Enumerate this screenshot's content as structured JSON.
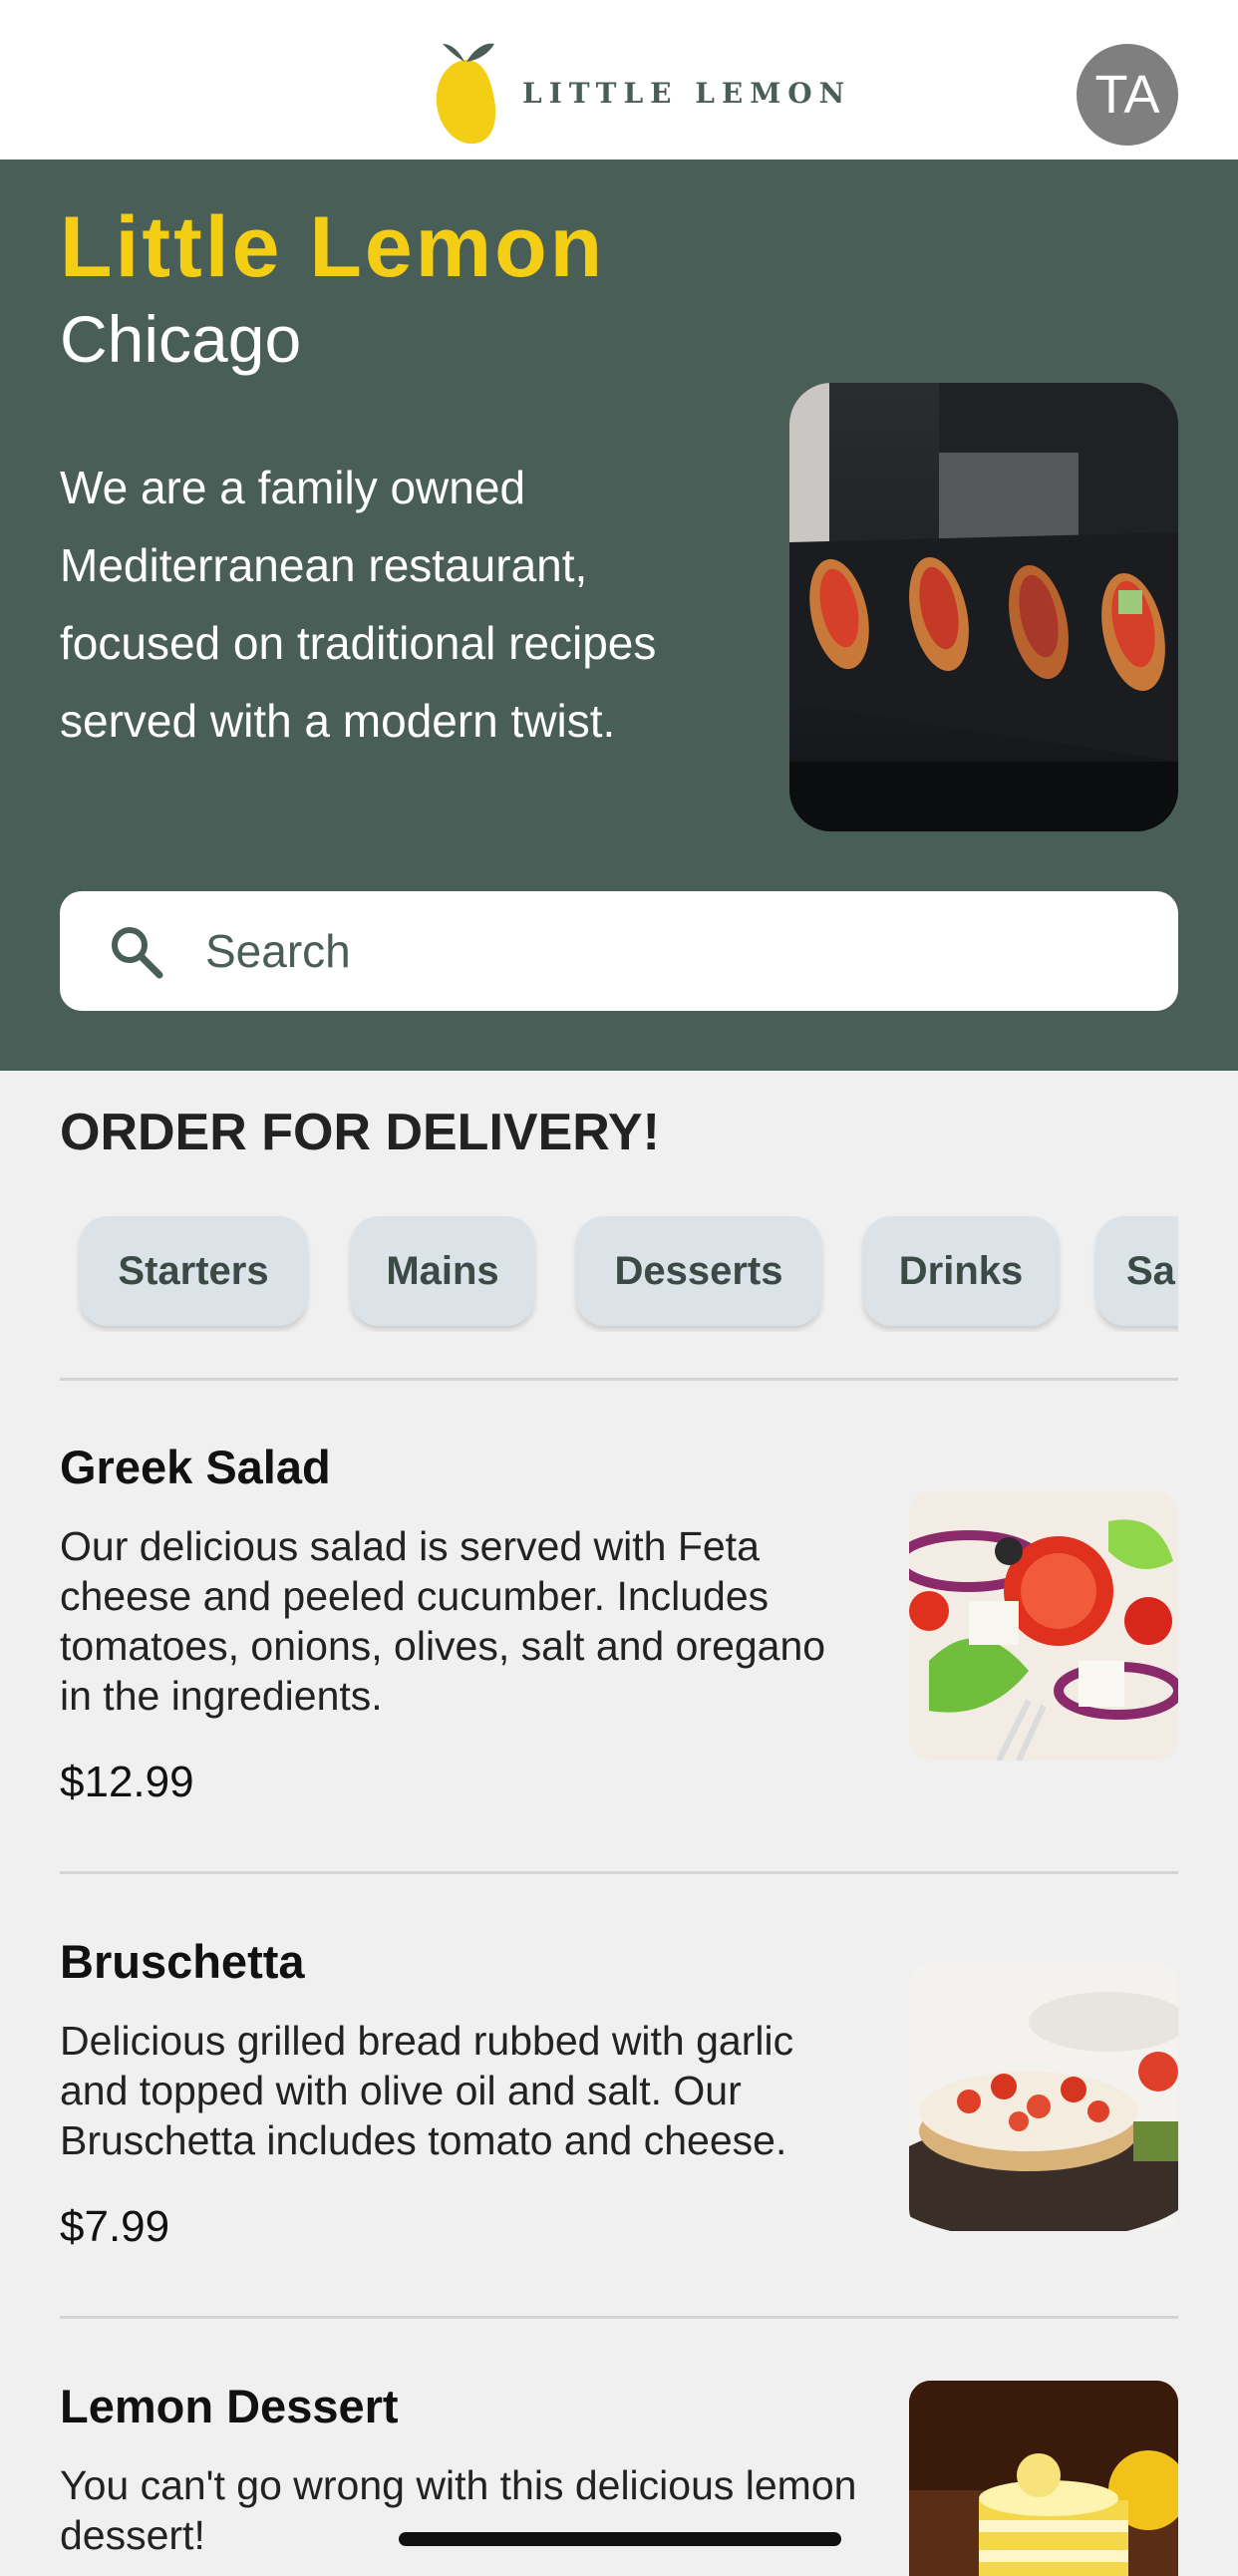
{
  "header": {
    "logo_text": "LITTLE LEMON",
    "avatar_initials": "TA"
  },
  "hero": {
    "title": "Little Lemon",
    "city": "Chicago",
    "description": "We are a family owned Mediterranean restaurant, focused on traditional recipes served with a modern twist.",
    "image_icon": "hero-food-image"
  },
  "search": {
    "placeholder": "Search",
    "icon": "search-icon"
  },
  "order": {
    "title": "ORDER FOR DELIVERY!",
    "categories": [
      "Starters",
      "Mains",
      "Desserts",
      "Drinks",
      "Sa"
    ]
  },
  "menu": [
    {
      "name": "Greek Salad",
      "description": "Our delicious salad is served with Feta cheese and peeled cucumber. Includes tomatoes, onions, olives, salt and oregano in the ingredients.",
      "price": "$12.99"
    },
    {
      "name": "Bruschetta",
      "description": "Delicious grilled bread rubbed with garlic and topped with olive oil and salt. Our Bruschetta includes tomato and cheese.",
      "price": "$7.99"
    },
    {
      "name": "Lemon Dessert",
      "description": "You can't go wrong with this delicious lemon dessert!",
      "price": ""
    }
  ],
  "colors": {
    "primary_green": "#495e57",
    "primary_yellow": "#f4ce14",
    "chip_bg": "#dbe3e9",
    "page_bg": "#f0f0f0"
  }
}
